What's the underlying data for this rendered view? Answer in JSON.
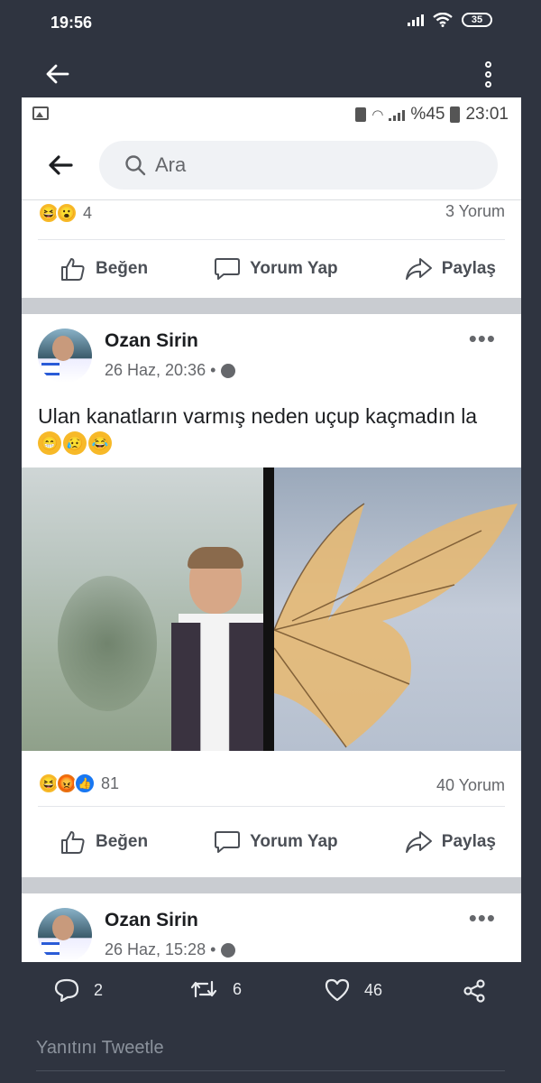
{
  "os_status": {
    "time": "19:56",
    "battery": "35"
  },
  "fb_status": {
    "battery_percent": "%45",
    "time": "23:01"
  },
  "search": {
    "placeholder": "Ara"
  },
  "prev_post": {
    "reaction_count": "4",
    "comments": "3 Yorum",
    "reactions": [
      "haha-emoji",
      "wow-emoji"
    ]
  },
  "actions": {
    "like": "Beğen",
    "comment": "Yorum Yap",
    "share": "Paylaş"
  },
  "post": {
    "author": "Ozan Sirin",
    "time": "26 Haz, 20:36 •",
    "text": "Ulan kanatların varmış neden uçup kaçmadın la",
    "text_emojis": [
      "😁",
      "😥",
      "😂"
    ],
    "reaction_count": "81",
    "comments": "40 Yorum",
    "reactions": [
      "haha-emoji",
      "angry-emoji",
      "like-emoji"
    ]
  },
  "next_post": {
    "author": "Ozan Sirin",
    "time": "26 Haz, 15:28 •"
  },
  "tweet_actions": {
    "replies": "2",
    "retweets": "6",
    "likes": "46"
  },
  "reply_placeholder": "Yanıtını Tweetle"
}
